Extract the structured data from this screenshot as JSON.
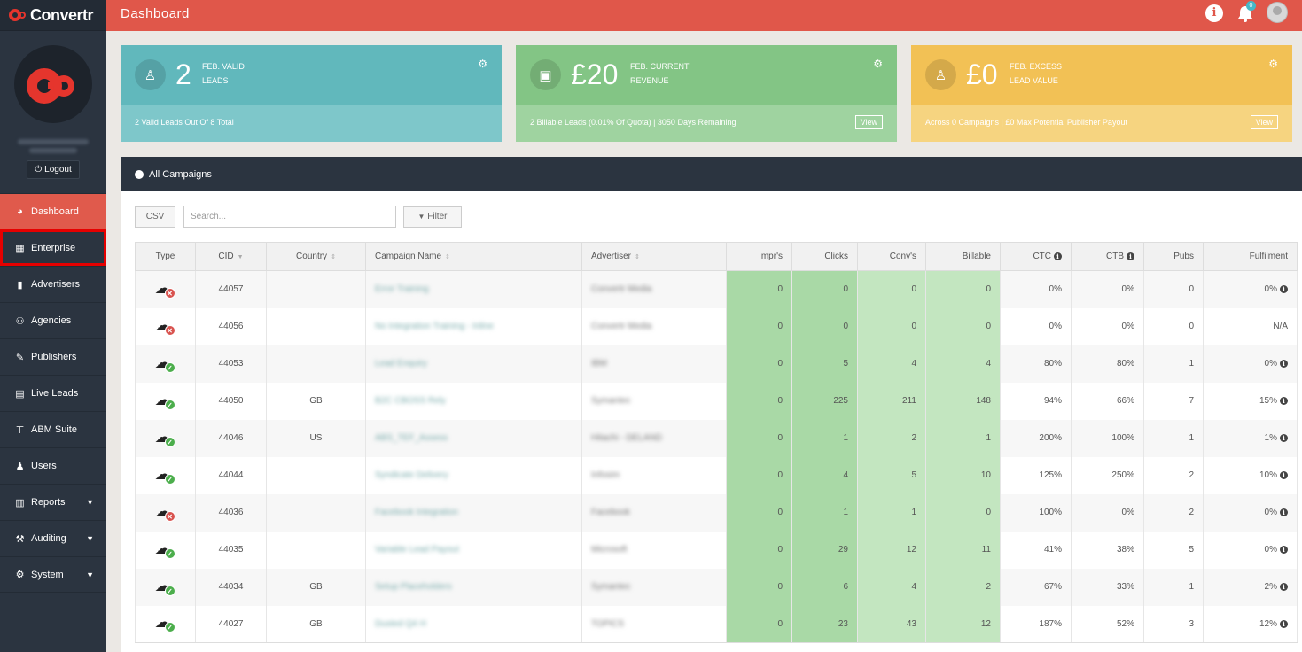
{
  "brand": {
    "name": "Convertr"
  },
  "header": {
    "title": "Dashboard",
    "notification_count": "0"
  },
  "profile": {
    "logout_label": "Logout"
  },
  "sidebar": {
    "items": [
      {
        "label": "Dashboard",
        "icon": "dashboard-icon",
        "glyph": "◕"
      },
      {
        "label": "Enterprise",
        "icon": "building-icon",
        "glyph": "▦"
      },
      {
        "label": "Advertisers",
        "icon": "book-icon",
        "glyph": "▮"
      },
      {
        "label": "Agencies",
        "icon": "user-network-icon",
        "glyph": "⚇"
      },
      {
        "label": "Publishers",
        "icon": "pencil-icon",
        "glyph": "✎"
      },
      {
        "label": "Live Leads",
        "icon": "list-icon",
        "glyph": "▤"
      },
      {
        "label": "ABM Suite",
        "icon": "sitemap-icon",
        "glyph": "⊤"
      },
      {
        "label": "Users",
        "icon": "users-icon",
        "glyph": "♟"
      },
      {
        "label": "Reports",
        "icon": "report-icon",
        "glyph": "▥"
      },
      {
        "label": "Auditing",
        "icon": "gavel-icon",
        "glyph": "⚒"
      },
      {
        "label": "System",
        "icon": "gear-icon",
        "glyph": "⚙"
      }
    ]
  },
  "cards": {
    "leads": {
      "value": "2",
      "label_line1": "FEB. VALID",
      "label_line2": "LEADS",
      "subtitle": "2 Valid Leads Out Of 8 Total"
    },
    "revenue": {
      "value": "£20",
      "label_line1": "FEB. CURRENT",
      "label_line2": "REVENUE",
      "subtitle": "2 Billable Leads (0.01% Of Quota) | 3050 Days Remaining",
      "view_label": "View"
    },
    "excess": {
      "value": "£0",
      "label_line1": "FEB. EXCESS",
      "label_line2": "LEAD VALUE",
      "subtitle": "Across 0 Campaigns | £0 Max Potential Publisher Payout",
      "view_label": "View"
    }
  },
  "campaigns": {
    "title": "All Campaigns",
    "csv_label": "CSV",
    "search_placeholder": "Search...",
    "filter_label": "Filter",
    "columns": [
      "Type",
      "CID",
      "Country",
      "Campaign Name",
      "Advertiser",
      "Impr's",
      "Clicks",
      "Conv's",
      "Billable",
      "CTC",
      "CTB",
      "Pubs",
      "Fulfilment"
    ],
    "rows": [
      {
        "status": "error",
        "cid": "44057",
        "country": "",
        "name": "Error Training",
        "advertiser": "Convertr Media",
        "imprs": "0",
        "clicks": "0",
        "convs": "0",
        "billable": "0",
        "ctc": "0%",
        "ctb": "0%",
        "pubs": "0",
        "fulfilment": "0%",
        "fulfilment_info": true
      },
      {
        "status": "error",
        "cid": "44056",
        "country": "",
        "name": "No Integration Training - Inline",
        "advertiser": "Convertr Media",
        "imprs": "0",
        "clicks": "0",
        "convs": "0",
        "billable": "0",
        "ctc": "0%",
        "ctb": "0%",
        "pubs": "0",
        "fulfilment": "N/A",
        "fulfilment_info": false
      },
      {
        "status": "ok",
        "cid": "44053",
        "country": "",
        "name": "Lead Enquiry",
        "advertiser": "IBM",
        "imprs": "0",
        "clicks": "5",
        "convs": "4",
        "billable": "4",
        "ctc": "80%",
        "ctb": "80%",
        "pubs": "1",
        "fulfilment": "0%",
        "fulfilment_info": true
      },
      {
        "status": "ok",
        "cid": "44050",
        "country": "GB",
        "name": "B2C CBOSS Rely",
        "advertiser": "Symantec",
        "imprs": "0",
        "clicks": "225",
        "convs": "211",
        "billable": "148",
        "ctc": "94%",
        "ctb": "66%",
        "pubs": "7",
        "fulfilment": "15%",
        "fulfilment_info": true
      },
      {
        "status": "ok",
        "cid": "44046",
        "country": "US",
        "name": "ABS_TEF_Assess",
        "advertiser": "Hitachi - DELAND",
        "imprs": "0",
        "clicks": "1",
        "convs": "2",
        "billable": "1",
        "ctc": "200%",
        "ctb": "100%",
        "pubs": "1",
        "fulfilment": "1%",
        "fulfilment_info": true
      },
      {
        "status": "ok",
        "cid": "44044",
        "country": "",
        "name": "Syndicate Delivery",
        "advertiser": "Infosim",
        "imprs": "0",
        "clicks": "4",
        "convs": "5",
        "billable": "10",
        "ctc": "125%",
        "ctb": "250%",
        "pubs": "2",
        "fulfilment": "10%",
        "fulfilment_info": true
      },
      {
        "status": "error",
        "cid": "44036",
        "country": "",
        "name": "Facebook Integration",
        "advertiser": "Facebook",
        "imprs": "0",
        "clicks": "1",
        "convs": "1",
        "billable": "0",
        "ctc": "100%",
        "ctb": "0%",
        "pubs": "2",
        "fulfilment": "0%",
        "fulfilment_info": true
      },
      {
        "status": "ok",
        "cid": "44035",
        "country": "",
        "name": "Variable Lead Payout",
        "advertiser": "Microsoft",
        "imprs": "0",
        "clicks": "29",
        "convs": "12",
        "billable": "11",
        "ctc": "41%",
        "ctb": "38%",
        "pubs": "5",
        "fulfilment": "0%",
        "fulfilment_info": true
      },
      {
        "status": "ok",
        "cid": "44034",
        "country": "GB",
        "name": "Setup Placeholders",
        "advertiser": "Symantec",
        "imprs": "0",
        "clicks": "6",
        "convs": "4",
        "billable": "2",
        "ctc": "67%",
        "ctb": "33%",
        "pubs": "1",
        "fulfilment": "2%",
        "fulfilment_info": true
      },
      {
        "status": "ok",
        "cid": "44027",
        "country": "GB",
        "name": "Dusted Q4 H",
        "advertiser": "TOPICS",
        "imprs": "0",
        "clicks": "23",
        "convs": "43",
        "billable": "12",
        "ctc": "187%",
        "ctb": "52%",
        "pubs": "3",
        "fulfilment": "12%",
        "fulfilment_info": true
      }
    ]
  },
  "colors": {
    "accent": "#e0574a",
    "sidebar": "#2b3440",
    "teal": "#61b8bc",
    "green": "#83c585",
    "yellow": "#f2c155"
  }
}
